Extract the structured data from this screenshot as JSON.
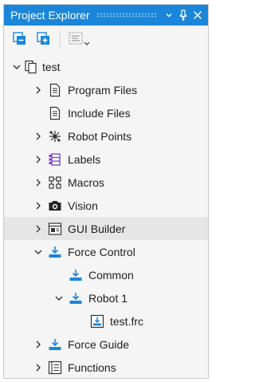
{
  "panel": {
    "title": "Project Explorer",
    "title_buttons": [
      {
        "name": "dropdown-icon"
      },
      {
        "name": "pin-icon"
      },
      {
        "name": "close-icon"
      }
    ],
    "accent_color": "#1a86d9"
  },
  "toolbar": {
    "buttons": [
      {
        "name": "collapse-all-icon"
      },
      {
        "name": "expand-all-icon"
      },
      {
        "name": "filter-dropdown-icon"
      }
    ]
  },
  "tree": {
    "root": {
      "label": "test",
      "icon": "project-icon",
      "expanded": true
    },
    "items": [
      {
        "label": "Program Files",
        "icon": "document-icon",
        "chevron": "collapsed"
      },
      {
        "label": "Include Files",
        "icon": "document-icon",
        "chevron": "none"
      },
      {
        "label": "Robot Points",
        "icon": "robot-points-icon",
        "chevron": "collapsed"
      },
      {
        "label": "Labels",
        "icon": "labels-icon",
        "chevron": "collapsed"
      },
      {
        "label": "Macros",
        "icon": "macros-icon",
        "chevron": "collapsed"
      },
      {
        "label": "Vision",
        "icon": "camera-icon",
        "chevron": "collapsed"
      },
      {
        "label": "GUI Builder",
        "icon": "gui-builder-icon",
        "chevron": "collapsed",
        "selected": true
      },
      {
        "label": "Force Control",
        "icon": "force-icon",
        "chevron": "expanded"
      },
      {
        "label": "Common",
        "icon": "force-icon",
        "chevron": "none"
      },
      {
        "label": "Robot 1",
        "icon": "force-icon",
        "chevron": "expanded"
      },
      {
        "label": "test.frc",
        "icon": "force-file-icon",
        "chevron": "none"
      },
      {
        "label": "Force Guide",
        "icon": "force-icon",
        "chevron": "collapsed"
      },
      {
        "label": "Functions",
        "icon": "functions-icon",
        "chevron": "collapsed"
      }
    ]
  }
}
